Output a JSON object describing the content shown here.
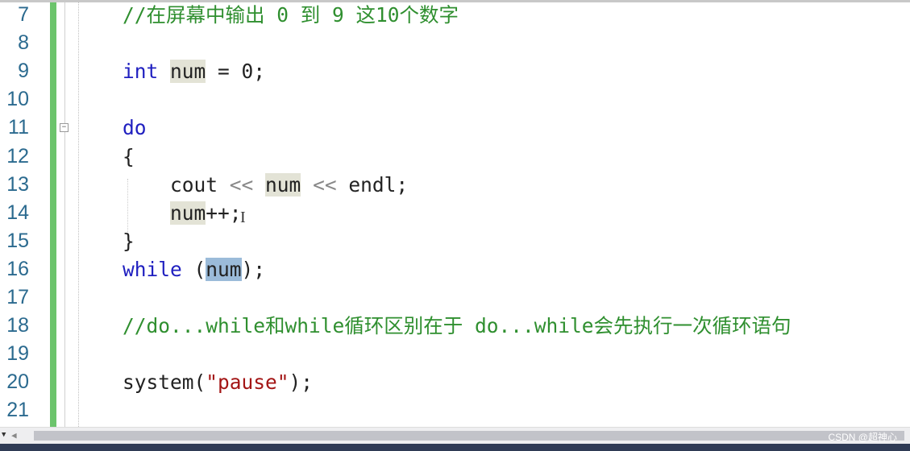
{
  "editor": {
    "lines": [
      {
        "n": "7",
        "tokens": [
          {
            "t": "//在屏幕中输出 0 到 9 这10个数字",
            "c": "cm"
          }
        ]
      },
      {
        "n": "8",
        "tokens": []
      },
      {
        "n": "9",
        "tokens": [
          {
            "t": "int",
            "c": "kw"
          },
          {
            "t": " "
          },
          {
            "t": "num",
            "c": "hl"
          },
          {
            "t": " = 0;"
          }
        ]
      },
      {
        "n": "10",
        "tokens": []
      },
      {
        "n": "11",
        "tokens": [
          {
            "t": "do",
            "c": "kw"
          }
        ]
      },
      {
        "n": "12",
        "tokens": [
          {
            "t": "{"
          }
        ]
      },
      {
        "n": "13",
        "tokens": [
          {
            "t": "    cout "
          },
          {
            "t": "<<",
            "c": "op"
          },
          {
            "t": " "
          },
          {
            "t": "num",
            "c": "hl"
          },
          {
            "t": " "
          },
          {
            "t": "<<",
            "c": "op"
          },
          {
            "t": " endl;"
          }
        ]
      },
      {
        "n": "14",
        "tokens": [
          {
            "t": "    "
          },
          {
            "t": "num",
            "c": "hl"
          },
          {
            "t": "++;"
          }
        ]
      },
      {
        "n": "15",
        "tokens": [
          {
            "t": "}"
          }
        ]
      },
      {
        "n": "16",
        "tokens": [
          {
            "t": "while",
            "c": "kw"
          },
          {
            "t": " ("
          },
          {
            "t": "num",
            "c": "sel"
          },
          {
            "t": ");"
          }
        ]
      },
      {
        "n": "17",
        "tokens": []
      },
      {
        "n": "18",
        "tokens": [
          {
            "t": "//do...while和while循环区别在于 do...while会先执行一次循环语句",
            "c": "cm"
          }
        ]
      },
      {
        "n": "19",
        "tokens": []
      },
      {
        "n": "20",
        "tokens": [
          {
            "t": "system("
          },
          {
            "t": "\"pause\"",
            "c": "st"
          },
          {
            "t": ");"
          }
        ]
      },
      {
        "n": "21",
        "tokens": []
      }
    ]
  },
  "watermark": "CSDN @超神心",
  "colors": {
    "keyword": "#2020c0",
    "comment": "#2f8f2f",
    "string": "#a31515",
    "change_bar": "#6cc46c",
    "selection": "#9bbbd9"
  }
}
